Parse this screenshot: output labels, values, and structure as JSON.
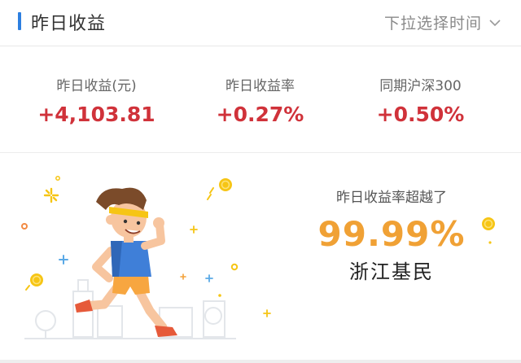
{
  "header": {
    "title": "昨日收益",
    "date_picker_label": "下拉选择时间",
    "accent_color": "#2d7fe0"
  },
  "stats": [
    {
      "label": "昨日收益(元)",
      "value": "+4,103.81"
    },
    {
      "label": "昨日收益率",
      "value": "+0.27%"
    },
    {
      "label": "同期沪深300",
      "value": "+0.50%"
    }
  ],
  "beat": {
    "caption": "昨日收益率超越了",
    "percent": "99.99%",
    "group": "浙江基民"
  },
  "colors": {
    "positive": "#d0323a",
    "highlight": "#f0a135",
    "coin": "#f6c515"
  },
  "icons": [
    "chevron-down-icon",
    "runner-illustration",
    "coin-icon",
    "sparkle-icon"
  ]
}
